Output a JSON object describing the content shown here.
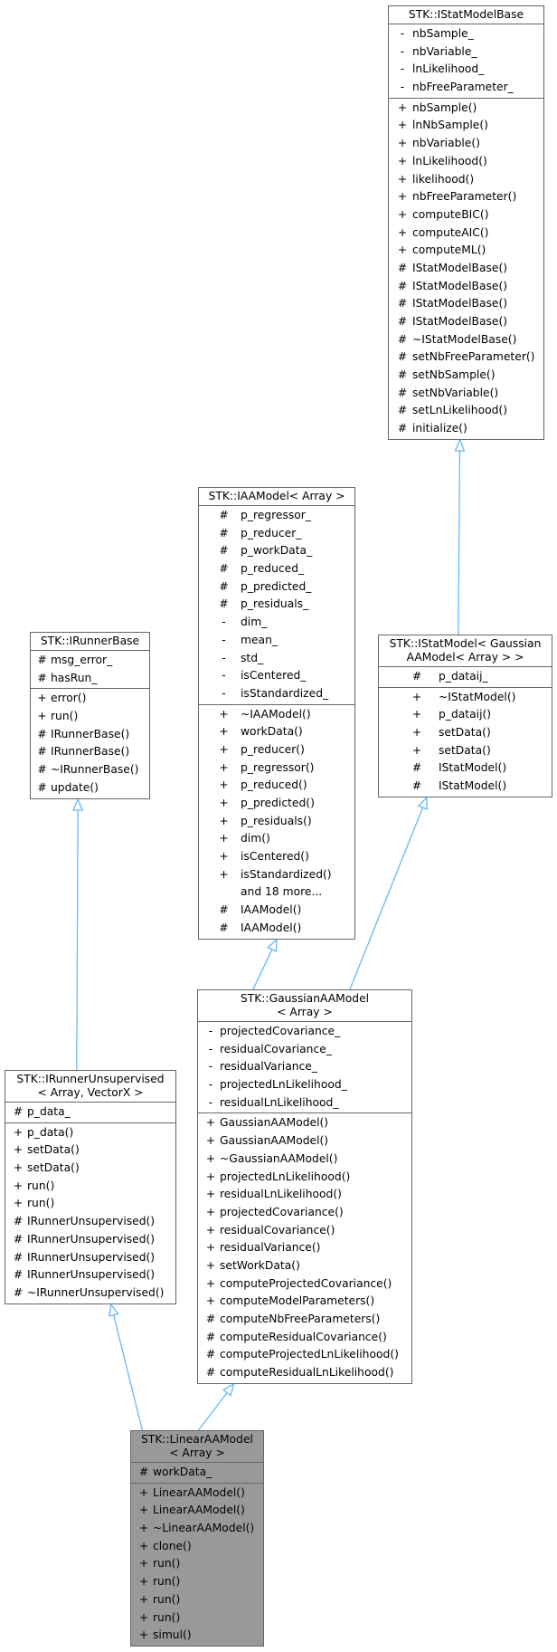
{
  "diagram": {
    "type": "class-inheritance-graph",
    "edge_color": "#63b8ff",
    "border_color": "#666666",
    "highlight_fill": "#999999",
    "nodes": {
      "istatmodelbase": {
        "title_lines": [
          "STK::IStatModelBase"
        ],
        "attributes": [
          {
            "vis": "-",
            "name": "nbSample_"
          },
          {
            "vis": "-",
            "name": "nbVariable_"
          },
          {
            "vis": "-",
            "name": "lnLikelihood_"
          },
          {
            "vis": "-",
            "name": "nbFreeParameter_"
          }
        ],
        "methods": [
          {
            "vis": "+",
            "name": "nbSample()"
          },
          {
            "vis": "+",
            "name": "lnNbSample()"
          },
          {
            "vis": "+",
            "name": "nbVariable()"
          },
          {
            "vis": "+",
            "name": "lnLikelihood()"
          },
          {
            "vis": "+",
            "name": "likelihood()"
          },
          {
            "vis": "+",
            "name": "nbFreeParameter()"
          },
          {
            "vis": "+",
            "name": "computeBIC()"
          },
          {
            "vis": "+",
            "name": "computeAIC()"
          },
          {
            "vis": "+",
            "name": "computeML()"
          },
          {
            "vis": "#",
            "name": "IStatModelBase()"
          },
          {
            "vis": "#",
            "name": "IStatModelBase()"
          },
          {
            "vis": "#",
            "name": "IStatModelBase()"
          },
          {
            "vis": "#",
            "name": "IStatModelBase()"
          },
          {
            "vis": "#",
            "name": "~IStatModelBase()"
          },
          {
            "vis": "#",
            "name": "setNbFreeParameter()"
          },
          {
            "vis": "#",
            "name": "setNbSample()"
          },
          {
            "vis": "#",
            "name": "setNbVariable()"
          },
          {
            "vis": "#",
            "name": "setLnLikelihood()"
          },
          {
            "vis": "#",
            "name": "initialize()"
          }
        ]
      },
      "iaamodel": {
        "title_lines": [
          "STK::IAAModel< Array >"
        ],
        "attributes": [
          {
            "vis": "#",
            "name": "p_regressor_"
          },
          {
            "vis": "#",
            "name": "p_reducer_"
          },
          {
            "vis": "#",
            "name": "p_workData_"
          },
          {
            "vis": "#",
            "name": "p_reduced_"
          },
          {
            "vis": "#",
            "name": "p_predicted_"
          },
          {
            "vis": "#",
            "name": "p_residuals_"
          },
          {
            "vis": "-",
            "name": "dim_"
          },
          {
            "vis": "-",
            "name": "mean_"
          },
          {
            "vis": "-",
            "name": "std_"
          },
          {
            "vis": "-",
            "name": "isCentered_"
          },
          {
            "vis": "-",
            "name": "isStandardized_"
          }
        ],
        "methods": [
          {
            "vis": "+",
            "name": "~IAAModel()"
          },
          {
            "vis": "+",
            "name": "workData()"
          },
          {
            "vis": "+",
            "name": "p_reducer()"
          },
          {
            "vis": "+",
            "name": "p_regressor()"
          },
          {
            "vis": "+",
            "name": "p_reduced()"
          },
          {
            "vis": "+",
            "name": "p_predicted()"
          },
          {
            "vis": "+",
            "name": "p_residuals()"
          },
          {
            "vis": "+",
            "name": "dim()"
          },
          {
            "vis": "+",
            "name": "isCentered()"
          },
          {
            "vis": "+",
            "name": "isStandardized()"
          },
          {
            "vis": "",
            "name": "and 18 more..."
          },
          {
            "vis": "#",
            "name": "IAAModel()"
          },
          {
            "vis": "#",
            "name": "IAAModel()"
          }
        ]
      },
      "irunnerbase": {
        "title_lines": [
          "STK::IRunnerBase"
        ],
        "attributes": [
          {
            "vis": "#",
            "name": "msg_error_"
          },
          {
            "vis": "#",
            "name": "hasRun_"
          }
        ],
        "methods": [
          {
            "vis": "+",
            "name": "error()"
          },
          {
            "vis": "+",
            "name": "run()"
          },
          {
            "vis": "#",
            "name": "IRunnerBase()"
          },
          {
            "vis": "#",
            "name": "IRunnerBase()"
          },
          {
            "vis": "#",
            "name": "~IRunnerBase()"
          },
          {
            "vis": "#",
            "name": "update()"
          }
        ]
      },
      "istatmodel": {
        "title_lines": [
          "STK::IStatModel< Gaussian",
          "AAModel< Array > >"
        ],
        "attributes": [
          {
            "vis": "#",
            "name": "p_dataij_"
          }
        ],
        "methods": [
          {
            "vis": "+",
            "name": "~IStatModel()"
          },
          {
            "vis": "+",
            "name": "p_dataij()"
          },
          {
            "vis": "+",
            "name": "setData()"
          },
          {
            "vis": "+",
            "name": "setData()"
          },
          {
            "vis": "#",
            "name": "IStatModel()"
          },
          {
            "vis": "#",
            "name": "IStatModel()"
          }
        ]
      },
      "gaussianaamodel": {
        "title_lines": [
          "STK::GaussianAAModel",
          "< Array >"
        ],
        "attributes": [
          {
            "vis": "-",
            "name": "projectedCovariance_"
          },
          {
            "vis": "-",
            "name": "residualCovariance_"
          },
          {
            "vis": "-",
            "name": "residualVariance_"
          },
          {
            "vis": "-",
            "name": "projectedLnLikelihood_"
          },
          {
            "vis": "-",
            "name": "residualLnLikelihood_"
          }
        ],
        "methods": [
          {
            "vis": "+",
            "name": "GaussianAAModel()"
          },
          {
            "vis": "+",
            "name": "GaussianAAModel()"
          },
          {
            "vis": "+",
            "name": "~GaussianAAModel()"
          },
          {
            "vis": "+",
            "name": "projectedLnLikelihood()"
          },
          {
            "vis": "+",
            "name": "residualLnLikelihood()"
          },
          {
            "vis": "+",
            "name": "projectedCovariance()"
          },
          {
            "vis": "+",
            "name": "residualCovariance()"
          },
          {
            "vis": "+",
            "name": "residualVariance()"
          },
          {
            "vis": "+",
            "name": "setWorkData()"
          },
          {
            "vis": "+",
            "name": "computeProjectedCovariance()"
          },
          {
            "vis": "+",
            "name": "computeModelParameters()"
          },
          {
            "vis": "#",
            "name": "computeNbFreeParameters()"
          },
          {
            "vis": "#",
            "name": "computeResidualCovariance()"
          },
          {
            "vis": "#",
            "name": "computeProjectedLnLikelihood()"
          },
          {
            "vis": "#",
            "name": "computeResidualLnLikelihood()"
          }
        ]
      },
      "irunnerunsupervised": {
        "title_lines": [
          "STK::IRunnerUnsupervised",
          "< Array, VectorX >"
        ],
        "attributes": [
          {
            "vis": "#",
            "name": "p_data_"
          }
        ],
        "methods": [
          {
            "vis": "+",
            "name": "p_data()"
          },
          {
            "vis": "+",
            "name": "setData()"
          },
          {
            "vis": "+",
            "name": "setData()"
          },
          {
            "vis": "+",
            "name": "run()"
          },
          {
            "vis": "+",
            "name": "run()"
          },
          {
            "vis": "#",
            "name": "IRunnerUnsupervised()"
          },
          {
            "vis": "#",
            "name": "IRunnerUnsupervised()"
          },
          {
            "vis": "#",
            "name": "IRunnerUnsupervised()"
          },
          {
            "vis": "#",
            "name": "IRunnerUnsupervised()"
          },
          {
            "vis": "#",
            "name": "~IRunnerUnsupervised()"
          }
        ]
      },
      "linearaamodel": {
        "title_lines": [
          "STK::LinearAAModel",
          "< Array >"
        ],
        "highlighted": true,
        "attributes": [
          {
            "vis": "#",
            "name": "workData_"
          }
        ],
        "methods": [
          {
            "vis": "+",
            "name": "LinearAAModel()"
          },
          {
            "vis": "+",
            "name": "LinearAAModel()"
          },
          {
            "vis": "+",
            "name": "~LinearAAModel()"
          },
          {
            "vis": "+",
            "name": "clone()"
          },
          {
            "vis": "+",
            "name": "run()"
          },
          {
            "vis": "+",
            "name": "run()"
          },
          {
            "vis": "+",
            "name": "run()"
          },
          {
            "vis": "+",
            "name": "run()"
          },
          {
            "vis": "+",
            "name": "simul()"
          }
        ]
      }
    },
    "edges": [
      {
        "from": "istatmodel",
        "to": "istatmodelbase",
        "relation": "inherits"
      },
      {
        "from": "gaussianaamodel",
        "to": "iaamodel",
        "relation": "inherits"
      },
      {
        "from": "gaussianaamodel",
        "to": "istatmodel",
        "relation": "inherits"
      },
      {
        "from": "irunnerunsupervised",
        "to": "irunnerbase",
        "relation": "inherits"
      },
      {
        "from": "linearaamodel",
        "to": "irunnerunsupervised",
        "relation": "inherits"
      },
      {
        "from": "linearaamodel",
        "to": "gaussianaamodel",
        "relation": "inherits"
      }
    ]
  }
}
